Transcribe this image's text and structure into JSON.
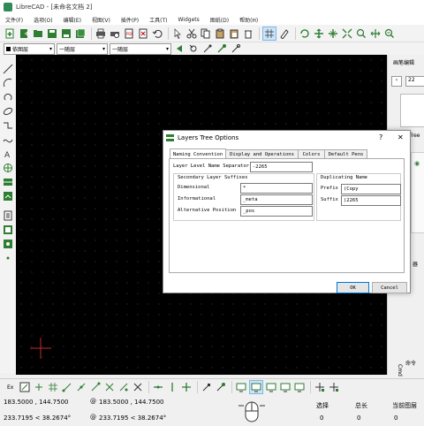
{
  "window": {
    "title": "LibreCAD - [未命名文档 2]"
  },
  "menu": [
    "文件(F)",
    "选项(O)",
    "编辑(E)",
    "视图(V)",
    "插件(P)",
    "工具(T)",
    "Widgets",
    "图纸(D)",
    "帮助(H)"
  ],
  "propbar": {
    "layer": "依图层",
    "linetype": "一随层",
    "linewidth": "一随层"
  },
  "right_dock": {
    "title": "画笔编辑",
    "value": "22",
    "tree_tab": "Tree",
    "filter_label": "器",
    "command_label": "命令",
    "cmd_tab": "Cmd"
  },
  "dialog": {
    "title": "Layers Tree Options",
    "help": "?",
    "close": "✕",
    "tabs": [
      "Naming Convention",
      "Display and Operations",
      "Colors",
      "Default Pens"
    ],
    "separator_label": "Layer Level Name Separator",
    "separator_value": "-2265",
    "secondary_title": "Secondary Layer Suffixes",
    "dimensional_label": "Dimensional",
    "dimensional_value": "*",
    "informational_label": "Informational",
    "informational_value": "_meta",
    "alternative_label": "Alternative Position",
    "alternative_value": "_pos",
    "dup_title": "Duplicating Name",
    "prefix_label": "Prefix",
    "prefix_value": "(Copy",
    "suffix_label": "Suffix",
    "suffix_value": ")2265",
    "ok": "OK",
    "cancel": "Cancel"
  },
  "status": {
    "coord1_abs": "183.5000 , 144.7500",
    "coord1_polar": "233.7195 < 38.2674°",
    "coord2_abs": "183.5000 , 144.7500",
    "coord2_polar": "233.7195 < 38.2674°",
    "select_label": "选择",
    "select_value": "0",
    "length_label": "总长",
    "length_value": "0",
    "layer_label": "当前图层",
    "layer_value": "0",
    "ex_label": "Ex"
  }
}
